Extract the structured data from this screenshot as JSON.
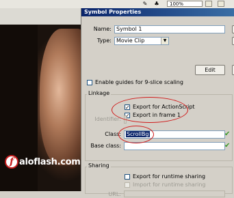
{
  "topbar": {
    "zoom": "100%"
  },
  "photo": {
    "brand_letter": "f",
    "brand_text": "aloflash.com"
  },
  "dialog": {
    "title": "Symbol Properties",
    "name_label": "Name:",
    "name_value": "Symbol 1",
    "type_label": "Type:",
    "type_value": "Movie Clip",
    "edit_label": "Edit",
    "guides_label": "Enable guides for 9-slice scaling",
    "linkage": {
      "legend": "Linkage",
      "export_as_label": "Export for ActionScript",
      "export_frame_label": "Export in frame 1",
      "identifier_label": "Identifier:",
      "class_label": "Class:",
      "class_value": "ScrollBg",
      "base_class_label": "Base class:"
    },
    "sharing": {
      "legend": "Sharing",
      "export_runtime_label": "Export for runtime sharing",
      "import_runtime_label": "Import for runtime sharing",
      "url_label": "URL:"
    }
  }
}
